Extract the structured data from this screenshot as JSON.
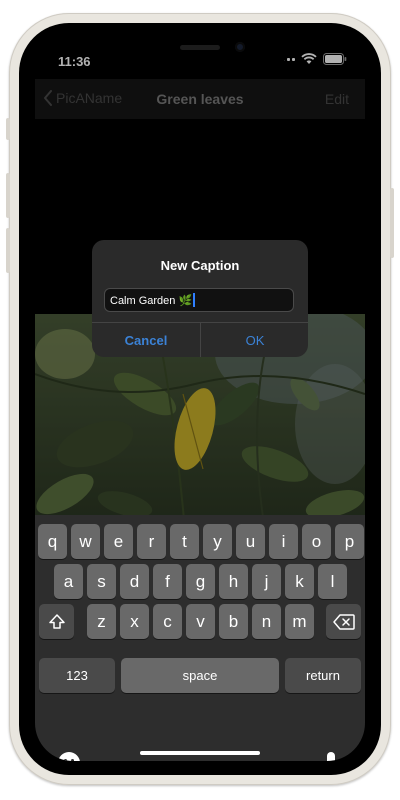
{
  "status_bar": {
    "time": "11:36"
  },
  "nav": {
    "back_label": "PicAName",
    "title": "Green leaves",
    "edit_label": "Edit"
  },
  "alert": {
    "title": "New Caption",
    "field_value": "Calm Garden 🌿",
    "cancel_label": "Cancel",
    "ok_label": "OK"
  },
  "keyboard": {
    "row1": [
      "q",
      "w",
      "e",
      "r",
      "t",
      "y",
      "u",
      "i",
      "o",
      "p"
    ],
    "row2": [
      "a",
      "s",
      "d",
      "f",
      "g",
      "h",
      "j",
      "k",
      "l"
    ],
    "row3": [
      "z",
      "x",
      "c",
      "v",
      "b",
      "n",
      "m"
    ],
    "numbers_label": "123",
    "space_label": "space",
    "return_label": "return"
  },
  "colors": {
    "accent": "#3b82d6",
    "key": "#696969",
    "key_dark": "#4a4a4a",
    "keyboard_bg": "#2d2d2d"
  },
  "icons": [
    "back-chevron-icon",
    "signal-icon",
    "wifi-icon",
    "battery-icon",
    "shift-icon",
    "delete-icon",
    "emoji-icon",
    "microphone-icon"
  ]
}
